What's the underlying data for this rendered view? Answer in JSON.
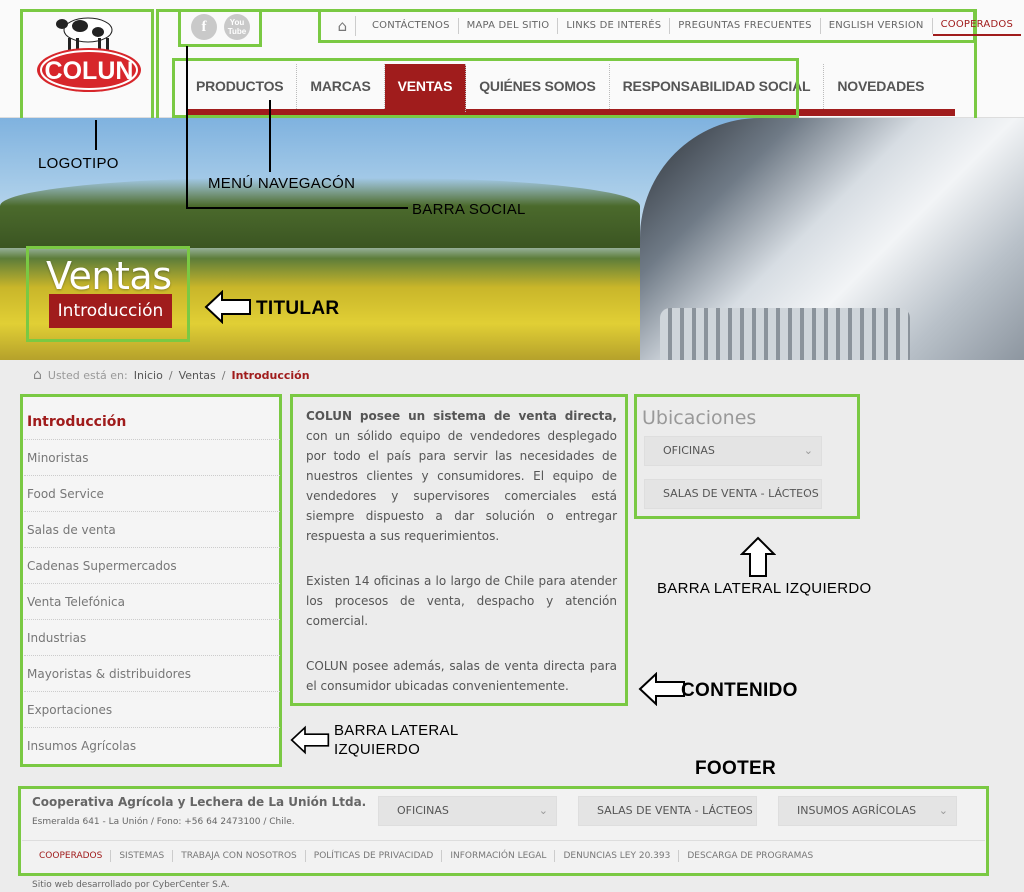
{
  "colors": {
    "accent": "#a01c1c",
    "annotation_outline": "#7ac943"
  },
  "logo": {
    "text": "COLUN"
  },
  "social": {
    "facebook": "f",
    "youtube_top": "You",
    "youtube_bottom": "Tube"
  },
  "toplinks": [
    "CONTÁCTENOS",
    "MAPA DEL SITIO",
    "LINKS DE INTERÉS",
    "PREGUNTAS FRECUENTES",
    "ENGLISH VERSION",
    "COOPERADOS"
  ],
  "nav": [
    "PRODUCTOS",
    "MARCAS",
    "VENTAS",
    "QUIÉNES SOMOS",
    "RESPONSABILIDAD SOCIAL",
    "NOVEDADES"
  ],
  "hero": {
    "title": "Ventas",
    "subtitle": "Introducción"
  },
  "annotations": {
    "logotipo": "LOGOTIPO",
    "menu": "MENÚ NAVEGACÓN",
    "social": "BARRA SOCIAL",
    "titular": "TITULAR",
    "contenido": "CONTENIDO",
    "sidebar_right": "BARRA LATERAL IZQUIERDO",
    "sidebar_left_1": "BARRA LATERAL",
    "sidebar_left_2": "IZQUIERDO",
    "footer": "FOOTER"
  },
  "breadcrumb": {
    "prefix": "Usted está en:",
    "items": [
      "Inicio",
      "Ventas",
      "Introducción"
    ]
  },
  "sidebar": [
    "Introducción",
    "Minoristas",
    "Food Service",
    "Salas de venta",
    "Cadenas Supermercados",
    "Venta Telefónica",
    "Industrias",
    "Mayoristas & distribuidores",
    "Exportaciones",
    "Insumos Agrícolas"
  ],
  "content": {
    "p1_bold": "COLUN posee un sistema de venta directa,",
    "p1_rest": " con un sólido equipo de vendedores desplegado por todo el país para servir las necesidades de nuestros clientes y consumidores. El equipo de vendedores y supervisores comerciales está siempre dispuesto a dar solución o entregar respuesta a sus requerimientos.",
    "p2": "Existen 14 oficinas a lo largo de Chile para atender los procesos de venta, despacho y atención comercial.",
    "p3": "COLUN posee además, salas de venta directa para el consumidor ubicadas convenientemente."
  },
  "ubicaciones": {
    "title": "Ubicaciones",
    "options": [
      "OFICINAS",
      "SALAS DE VENTA - LÁCTEOS"
    ]
  },
  "footer": {
    "org": "Cooperativa Agrícola y Lechera de La Unión Ltda.",
    "address": "Esmeralda 641 - La Unión / Fono: +56 64 2473100 / Chile.",
    "selects": [
      "OFICINAS",
      "SALAS DE VENTA - LÁCTEOS",
      "INSUMOS AGRÍCOLAS"
    ],
    "links": [
      "COOPERADOS",
      "SISTEMAS",
      "TRABAJA CON NOSOTROS",
      "POLÍTICAS DE PRIVACIDAD",
      "INFORMACIÓN LEGAL",
      "DENUNCIAS LEY 20.393",
      "DESCARGA DE PROGRAMAS"
    ],
    "credit": "Sitio web desarrollado por CyberCenter S.A."
  }
}
